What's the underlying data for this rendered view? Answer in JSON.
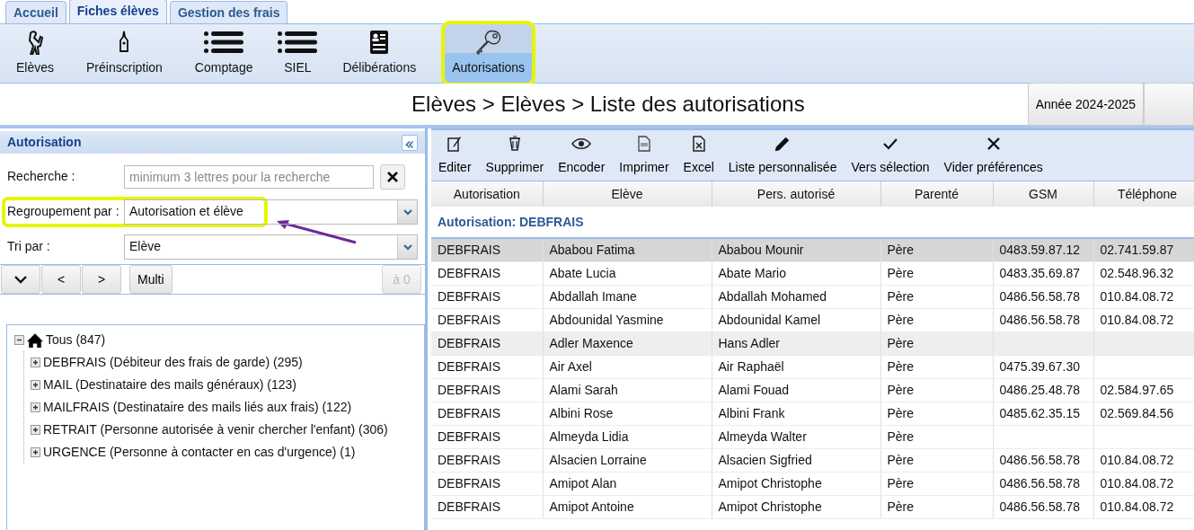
{
  "tabs": [
    {
      "label": "Accueil",
      "selected": false
    },
    {
      "label": "Fiches élèves",
      "selected": true
    },
    {
      "label": "Gestion des frais",
      "selected": false
    }
  ],
  "ribbon": [
    {
      "label": "Elèves",
      "kind": "student",
      "selected": false,
      "highlighted": false
    },
    {
      "label": "Préinscription",
      "kind": "nib",
      "selected": false,
      "highlighted": false
    },
    {
      "label": "Comptage",
      "kind": "list",
      "selected": false,
      "highlighted": false
    },
    {
      "label": "SIEL",
      "kind": "list",
      "selected": false,
      "highlighted": false
    },
    {
      "label": "Délibérations",
      "kind": "card",
      "selected": false,
      "highlighted": false
    },
    {
      "label": "Autorisations",
      "kind": "key",
      "selected": true,
      "highlighted": true
    }
  ],
  "breadcrumb": "Elèves > Elèves > Liste des autorisations",
  "year_button": "Année 2024-2025",
  "panel": {
    "title": "Autorisation",
    "search": {
      "label": "Recherche :",
      "placeholder": "minimum 3 lettres pour la recherche"
    },
    "group_by": {
      "label": "Regroupement par :",
      "value": "Autorisation et élève",
      "highlighted": true
    },
    "sort_by": {
      "label": "Tri par :",
      "value": "Elève"
    },
    "nav_buttons": [
      "<",
      ">"
    ],
    "multi_button": "Multi",
    "reset_button": {
      "label": "à 0",
      "disabled": true
    }
  },
  "tree": {
    "label": "Tous (847)",
    "expanded": true,
    "children": [
      {
        "label": "DEBFRAIS (Débiteur des frais de garde) (295)",
        "expanded": false
      },
      {
        "label": "MAIL (Destinataire des mails généraux) (123)",
        "expanded": false
      },
      {
        "label": "MAILFRAIS (Destinataire des mails liés aux frais) (122)",
        "expanded": false
      },
      {
        "label": "RETRAIT (Personne autorisée à venir chercher l'enfant) (306)",
        "expanded": false
      },
      {
        "label": "URGENCE (Personne à contacter en cas d'urgence) (1)",
        "expanded": false
      }
    ]
  },
  "toolbar": [
    {
      "label": "Editer",
      "kind": "edit"
    },
    {
      "label": "Supprimer",
      "kind": "trash"
    },
    {
      "label": "Encoder",
      "kind": "eye"
    },
    {
      "label": "Imprimer",
      "kind": "pdf"
    },
    {
      "label": "Excel",
      "kind": "excel"
    },
    {
      "label": "Liste personnalisée",
      "kind": "pencil"
    },
    {
      "label": "Vers sélection",
      "kind": "check"
    },
    {
      "label": "Vider préférences",
      "kind": "cross"
    }
  ],
  "table": {
    "columns": [
      "Autorisation",
      "Elève",
      "Pers. autorisé",
      "Parenté",
      "GSM",
      "Téléphone"
    ],
    "group": "Autorisation: DEBFRAIS",
    "rows": [
      {
        "cells": [
          "DEBFRAIS",
          "Ababou Fatima",
          "Ababou Mounir",
          "Père",
          "0483.59.87.12",
          "02.741.59.87"
        ],
        "selected": true,
        "highlighted": false
      },
      {
        "cells": [
          "DEBFRAIS",
          "Abate Lucia",
          "Abate Mario",
          "Père",
          "0483.35.69.87",
          "02.548.96.32"
        ],
        "selected": false,
        "highlighted": false
      },
      {
        "cells": [
          "DEBFRAIS",
          "Abdallah Imane",
          "Abdallah Mohamed",
          "Père",
          "0486.56.58.78",
          "010.84.08.72"
        ],
        "selected": false,
        "highlighted": false
      },
      {
        "cells": [
          "DEBFRAIS",
          "Abdounidal Yasmine",
          "Abdounidal Kamel",
          "Père",
          "0486.56.58.78",
          "010.84.08.72"
        ],
        "selected": false,
        "highlighted": false
      },
      {
        "cells": [
          "DEBFRAIS",
          "Adler Maxence",
          "Hans Adler",
          "Père",
          "",
          ""
        ],
        "selected": false,
        "highlighted": true
      },
      {
        "cells": [
          "DEBFRAIS",
          "Air Axel",
          "Air Raphaël",
          "Père",
          "0475.39.67.30",
          ""
        ],
        "selected": false,
        "highlighted": false
      },
      {
        "cells": [
          "DEBFRAIS",
          "Alami Sarah",
          "Alami Fouad",
          "Père",
          "0486.25.48.78",
          "02.584.97.65"
        ],
        "selected": false,
        "highlighted": false
      },
      {
        "cells": [
          "DEBFRAIS",
          "Albini Rose",
          "Albini Frank",
          "Père",
          "0485.62.35.15",
          "02.569.84.56"
        ],
        "selected": false,
        "highlighted": false
      },
      {
        "cells": [
          "DEBFRAIS",
          "Almeyda Lidia",
          "Almeyda Walter",
          "Père",
          "",
          ""
        ],
        "selected": false,
        "highlighted": false
      },
      {
        "cells": [
          "DEBFRAIS",
          "Alsacien Lorraine",
          "Alsacien Sigfried",
          "Père",
          "0486.56.58.78",
          "010.84.08.72"
        ],
        "selected": false,
        "highlighted": false
      },
      {
        "cells": [
          "DEBFRAIS",
          "Amipot Alan",
          "Amipot Christophe",
          "Père",
          "0486.56.58.78",
          "010.84.08.72"
        ],
        "selected": false,
        "highlighted": false
      },
      {
        "cells": [
          "DEBFRAIS",
          "Amipot Antoine",
          "Amipot Christophe",
          "Père",
          "0486.56.58.78",
          "010.84.08.72"
        ],
        "selected": false,
        "highlighted": false
      }
    ]
  }
}
